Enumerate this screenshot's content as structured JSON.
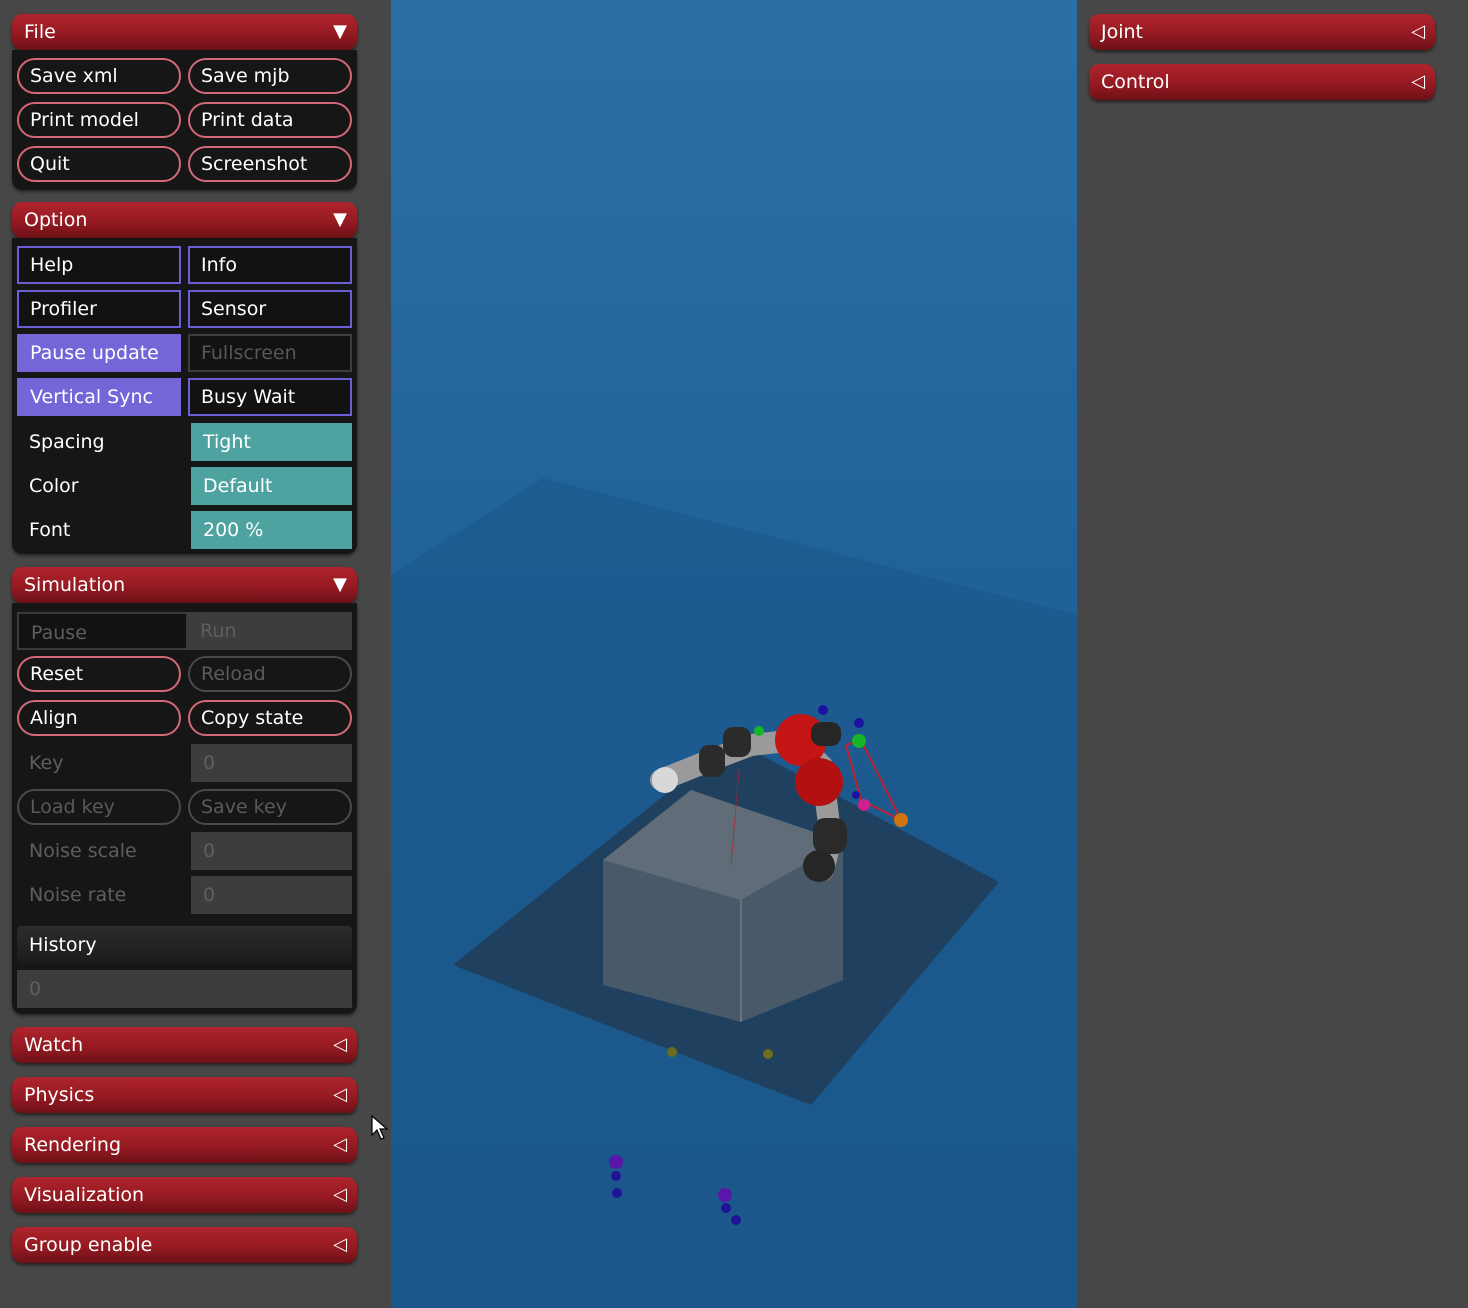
{
  "left_panel": {
    "file": {
      "title": "File",
      "buttons": [
        "Save xml",
        "Save mjb",
        "Print model",
        "Print data",
        "Quit",
        "Screenshot"
      ]
    },
    "option": {
      "title": "Option",
      "toggles": [
        {
          "label": "Help",
          "state": "off"
        },
        {
          "label": "Info",
          "state": "off"
        },
        {
          "label": "Profiler",
          "state": "off"
        },
        {
          "label": "Sensor",
          "state": "off"
        },
        {
          "label": "Pause update",
          "state": "on"
        },
        {
          "label": "Fullscreen",
          "state": "disabled"
        },
        {
          "label": "Vertical Sync",
          "state": "on"
        },
        {
          "label": "Busy Wait",
          "state": "off"
        }
      ],
      "selects": [
        {
          "label": "Spacing",
          "value": "Tight"
        },
        {
          "label": "Color",
          "value": "Default"
        },
        {
          "label": "Font",
          "value": "200 %"
        }
      ]
    },
    "simulation": {
      "title": "Simulation",
      "radio": [
        "Pause",
        "Run"
      ],
      "buttons": [
        "Reset",
        "Reload",
        "Align",
        "Copy state"
      ],
      "key": {
        "label": "Key",
        "value": "0"
      },
      "key_buttons": [
        "Load key",
        "Save key"
      ],
      "noise_scale": {
        "label": "Noise scale",
        "value": "0"
      },
      "noise_rate": {
        "label": "Noise rate",
        "value": "0"
      },
      "history": {
        "label": "History",
        "value": "0"
      }
    },
    "collapsed_sections": [
      "Watch",
      "Physics",
      "Rendering",
      "Visualization",
      "Group enable"
    ]
  },
  "right_panel": {
    "sections": [
      "Joint",
      "Control"
    ]
  },
  "icons": {
    "expanded": "triangle-down-icon",
    "collapsed": "triangle-left-icon"
  },
  "colors": {
    "section_header": "#a01f27",
    "toggle_on": "#7466d8",
    "select_bg": "#4ea3a0",
    "viewport_bg": "#1f629a"
  }
}
